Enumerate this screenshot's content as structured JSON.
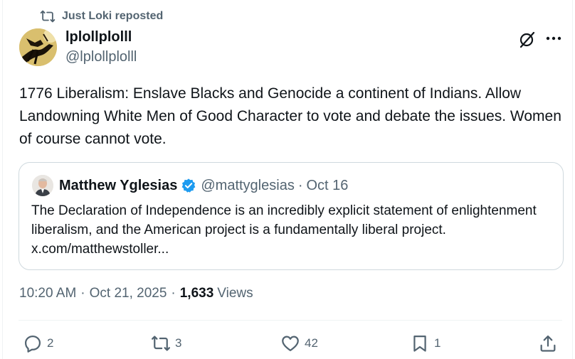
{
  "repost_banner": {
    "label": "Just Loki reposted",
    "icon": "repost-icon"
  },
  "author": {
    "display_name": "lplollplolll",
    "handle": "@lplollplolll"
  },
  "post": {
    "text": "1776 Liberalism: Enslave Blacks and Genocide a continent of Indians. Allow Landowning White Men of Good Character to vote and debate the issues. Women of course cannot vote."
  },
  "quoted": {
    "display_name": "Matthew Yglesias",
    "verified": true,
    "handle": "@mattyglesias",
    "separator": "·",
    "date": "Oct 16",
    "text": "The Declaration of Independence is an incredibly explicit statement of enlightenment liberalism, and the American project is a fundamentally liberal project. x.com/matthewstoller..."
  },
  "meta": {
    "time": "10:20 AM",
    "separator": "·",
    "date": "Oct 21, 2025",
    "separator2": "·",
    "views_count": "1,633",
    "views_label": "Views"
  },
  "actions": {
    "replies": "2",
    "reposts": "3",
    "likes": "42",
    "bookmarks": "1"
  },
  "colors": {
    "text_primary": "#0f1419",
    "text_secondary": "#536471",
    "border": "#cfd9de",
    "verified": "#1d9bf0"
  }
}
